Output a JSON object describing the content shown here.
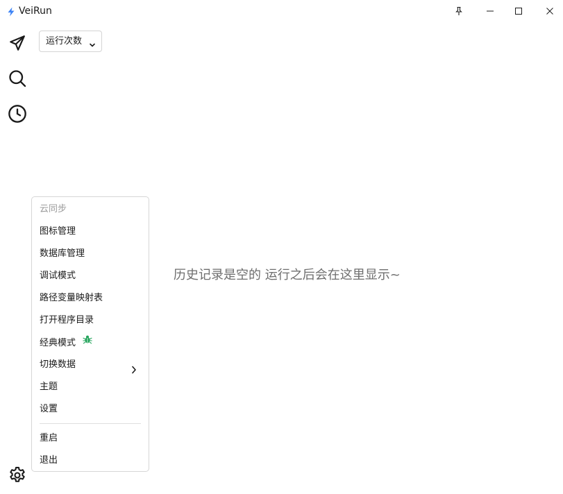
{
  "app": {
    "title": "VeiRun",
    "accent": "#3b82f6"
  },
  "window_controls": {
    "pin_icon": "pin-icon",
    "minimize_icon": "minimize-icon",
    "maximize_icon": "maximize-icon",
    "close_icon": "close-icon"
  },
  "rail": {
    "items": [
      {
        "icon": "send-icon"
      },
      {
        "icon": "search-icon"
      },
      {
        "icon": "history-icon"
      },
      {
        "icon": "settings-icon"
      }
    ]
  },
  "filter": {
    "selected": "运行次数",
    "icon": "chevron-down-icon"
  },
  "empty_state": {
    "message": "历史记录是空的 运行之后会在这里显示~"
  },
  "menu": {
    "items": [
      {
        "label": "云同步",
        "disabled": true
      },
      {
        "label": "图标管理"
      },
      {
        "label": "数据库管理"
      },
      {
        "label": "调试模式"
      },
      {
        "label": "路径变量映射表"
      },
      {
        "label": "打开程序目录"
      },
      {
        "label": "经典模式",
        "icon": "bug-icon",
        "icon_color": "#22a35a"
      },
      {
        "label": "切换数据",
        "submenu": true
      },
      {
        "label": "主题"
      },
      {
        "label": "设置"
      },
      {
        "label": "重启"
      },
      {
        "label": "退出"
      }
    ]
  }
}
